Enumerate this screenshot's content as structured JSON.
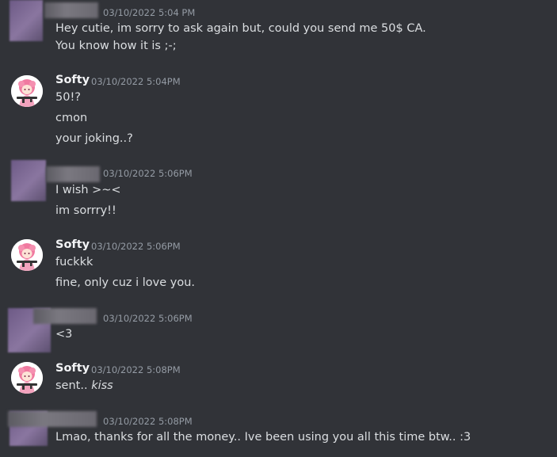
{
  "messages": [
    {
      "author": "",
      "timestamp": "03/10/2022 5:04 PM",
      "lines": [
        "Hey cutie, im sorry to ask again but, could you send me 50$ CA.",
        "You know how it is ;-;"
      ]
    },
    {
      "author": "Softy",
      "timestamp": "03/10/2022 5:04PM",
      "lines": [
        "50!?",
        "cmon",
        "your joking..?"
      ]
    },
    {
      "author": "",
      "timestamp": "03/10/2022 5:06PM",
      "lines": [
        "I wish >~<",
        "im sorrry!!"
      ]
    },
    {
      "author": "Softy",
      "timestamp": "03/10/2022 5:06PM",
      "lines": [
        "fuckkk",
        "fine, only cuz i love you."
      ]
    },
    {
      "author": "",
      "timestamp": "03/10/2022 5:06PM",
      "lines": [
        "<3"
      ]
    },
    {
      "author": "Softy",
      "timestamp": "03/10/2022 5:08PM",
      "lines": [
        "sent.. ",
        "kiss"
      ]
    },
    {
      "author": "",
      "timestamp": "03/10/2022 5:08PM",
      "lines": [
        "Lmao, thanks for all the money.. Ive been using you all this time btw.. :3"
      ]
    }
  ],
  "avatar_icon": "anime-girl-avatar-icon",
  "colors": {
    "background": "#313338",
    "text": "#dbdee1",
    "username": "#f2f3f5",
    "timestamp": "#949ba4"
  }
}
